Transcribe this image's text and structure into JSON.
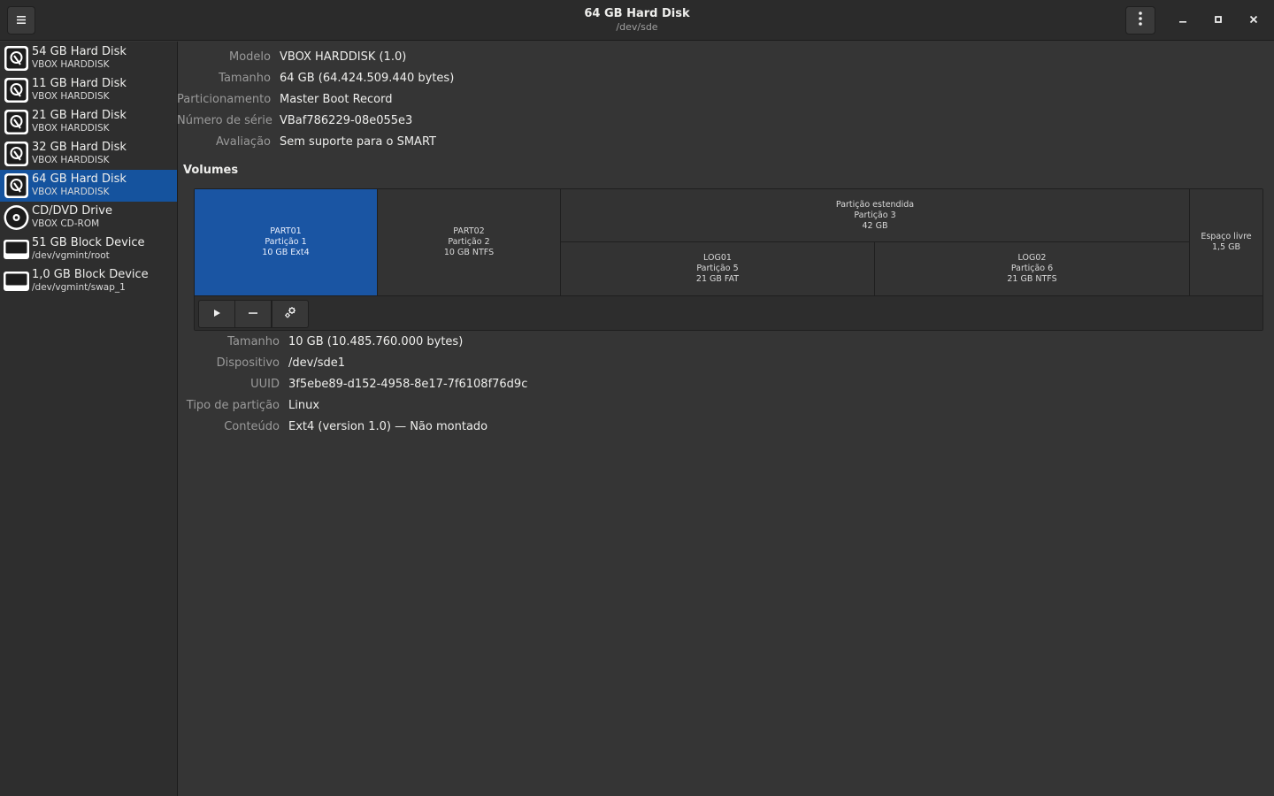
{
  "header": {
    "title": "64 GB Hard Disk",
    "subtitle": "/dev/sde",
    "menu_icon": "hamburger-menu-icon",
    "more_icon": "vertical-dots-icon"
  },
  "sidebar": {
    "items": [
      {
        "name": "54 GB Hard Disk",
        "sub": "VBOX HARDDISK",
        "icon": "hard-disk-icon"
      },
      {
        "name": "11 GB Hard Disk",
        "sub": "VBOX HARDDISK",
        "icon": "hard-disk-icon"
      },
      {
        "name": "21 GB Hard Disk",
        "sub": "VBOX HARDDISK",
        "icon": "hard-disk-icon"
      },
      {
        "name": "32 GB Hard Disk",
        "sub": "VBOX HARDDISK",
        "icon": "hard-disk-icon"
      },
      {
        "name": "64 GB Hard Disk",
        "sub": "VBOX HARDDISK",
        "icon": "hard-disk-icon",
        "selected": true
      },
      {
        "name": "CD/DVD Drive",
        "sub": "VBOX CD-ROM",
        "icon": "optical-drive-icon"
      },
      {
        "name": "51 GB Block Device",
        "sub": "/dev/vgmint/root",
        "icon": "block-device-icon"
      },
      {
        "name": "1,0 GB Block Device",
        "sub": "/dev/vgmint/swap_1",
        "icon": "block-device-icon"
      }
    ]
  },
  "disk_info": {
    "rows": [
      {
        "label": "Modelo",
        "value": "VBOX HARDDISK (1.0)"
      },
      {
        "label": "Tamanho",
        "value": "64 GB (64.424.509.440 bytes)"
      },
      {
        "label": "Particionamento",
        "value": "Master Boot Record"
      },
      {
        "label": "Número de série",
        "value": "VBaf786229-08e055e3"
      },
      {
        "label": "Avaliação",
        "value": "Sem suporte para o SMART"
      }
    ]
  },
  "volumes": {
    "title": "Volumes",
    "part1": {
      "l1": "PART01",
      "l2": "Partição 1",
      "l3": "10 GB Ext4"
    },
    "part2": {
      "l1": "PART02",
      "l2": "Partição 2",
      "l3": "10 GB NTFS"
    },
    "extended": {
      "l1": "Partição estendida",
      "l2": "Partição 3",
      "l3": "42 GB"
    },
    "log1": {
      "l1": "LOG01",
      "l2": "Partição 5",
      "l3": "21 GB FAT"
    },
    "log2": {
      "l1": "LOG02",
      "l2": "Partição 6",
      "l3": "21 GB NTFS"
    },
    "free": {
      "l1": "Espaço livre",
      "l2": "1,5 GB"
    },
    "toolbar": {
      "mount_icon": "play-icon",
      "remove_icon": "minus-icon",
      "settings_icon": "gears-icon"
    }
  },
  "partition_info": {
    "rows": [
      {
        "label": "Tamanho",
        "value": "10 GB (10.485.760.000 bytes)"
      },
      {
        "label": "Dispositivo",
        "value": "/dev/sde1"
      },
      {
        "label": "UUID",
        "value": "3f5ebe89-d152-4958-8e17-7f6108f76d9c"
      },
      {
        "label": "Tipo de partição",
        "value": "Linux"
      },
      {
        "label": "Conteúdo",
        "value": "Ext4 (version 1.0) — Não montado"
      }
    ]
  }
}
